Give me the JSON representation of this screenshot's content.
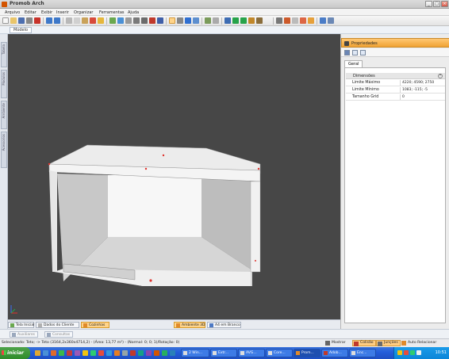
{
  "window": {
    "title": "Promob Arch"
  },
  "menu": [
    "Arquivo",
    "Editar",
    "Exibir",
    "Inserir",
    "Organizar",
    "Ferramentas",
    "Ajuda"
  ],
  "doc_tab": "Modelo",
  "left_strip": [
    "Tabela",
    "Modulos",
    "Ambiente",
    "Acessorios"
  ],
  "view_tabs": {
    "left": [
      "Tela Inicial",
      "Dados do Cliente",
      "Cozinhas"
    ],
    "center": [
      "Ambiente 3D",
      "A4 em Branco"
    ]
  },
  "properties": {
    "title": "Propriedades",
    "tab": "Geral",
    "section": "Dimensões",
    "rows": [
      {
        "label": "Limite Máximo",
        "value": "4220; 4590; 2750"
      },
      {
        "label": "Limite Mínimo",
        "value": "1083; -115; -5"
      },
      {
        "label": "Tamanho Grid",
        "value": "0"
      }
    ]
  },
  "bottom_tabs": [
    "Auxiliares",
    "Consultas"
  ],
  "status": {
    "selection": "Selecionado: Teto; -> Teto (3164,2x360x4714,2) - (Área: 13,77 m²) - (Normal: 0; 0; 1)/Rotação: 0)",
    "mostrar": "Mostrar",
    "colisao": "Colisão",
    "juncoes": "Junções",
    "auto_relacionar": "Auto Relacionar"
  },
  "taskbar": {
    "start": "iniciar",
    "tasks": [
      "2 Win...",
      "Extr...",
      "AVG...",
      "Core...",
      "Prom...",
      "Adob...",
      "Enc..."
    ],
    "clock": "10:51"
  },
  "colors": {
    "viewport_bg": "#474747",
    "active_tab": "#ffd48a",
    "props_header": "#f0a233",
    "taskbar": "#245edb"
  }
}
